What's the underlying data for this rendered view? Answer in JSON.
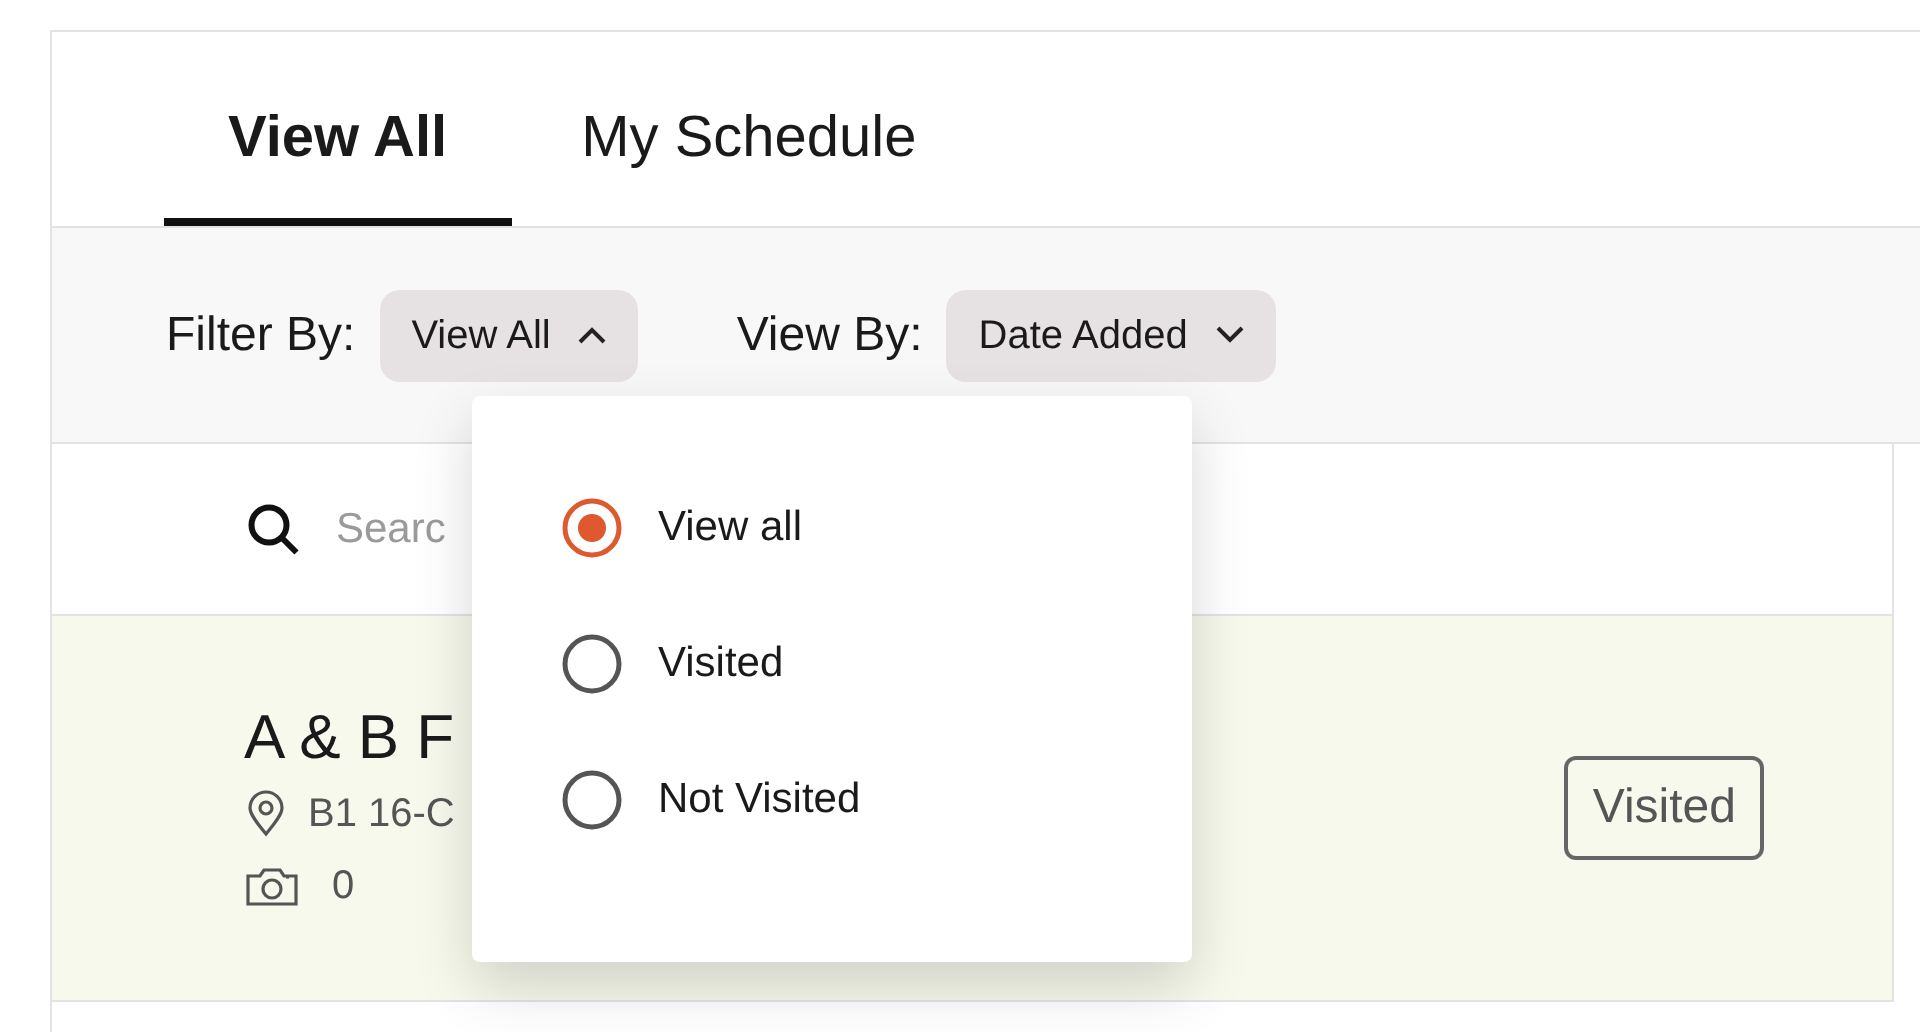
{
  "tabs": [
    {
      "label": "View All",
      "selected": true
    },
    {
      "label": "My Schedule",
      "selected": false
    }
  ],
  "filter_bar": {
    "filter_label": "Filter By:",
    "filter_value": "View All",
    "filter_expanded": true,
    "view_label": "View By:",
    "view_value": "Date Added"
  },
  "search": {
    "placeholder": "Searc"
  },
  "locations": [
    {
      "name": "A & B F",
      "address": "B1 16-C",
      "photo_count": "0",
      "status": "Visited"
    }
  ],
  "filter_menu": [
    {
      "label": "View all",
      "selected": true
    },
    {
      "label": "Visited",
      "selected": false
    },
    {
      "label": "Not Visited",
      "selected": false
    }
  ]
}
